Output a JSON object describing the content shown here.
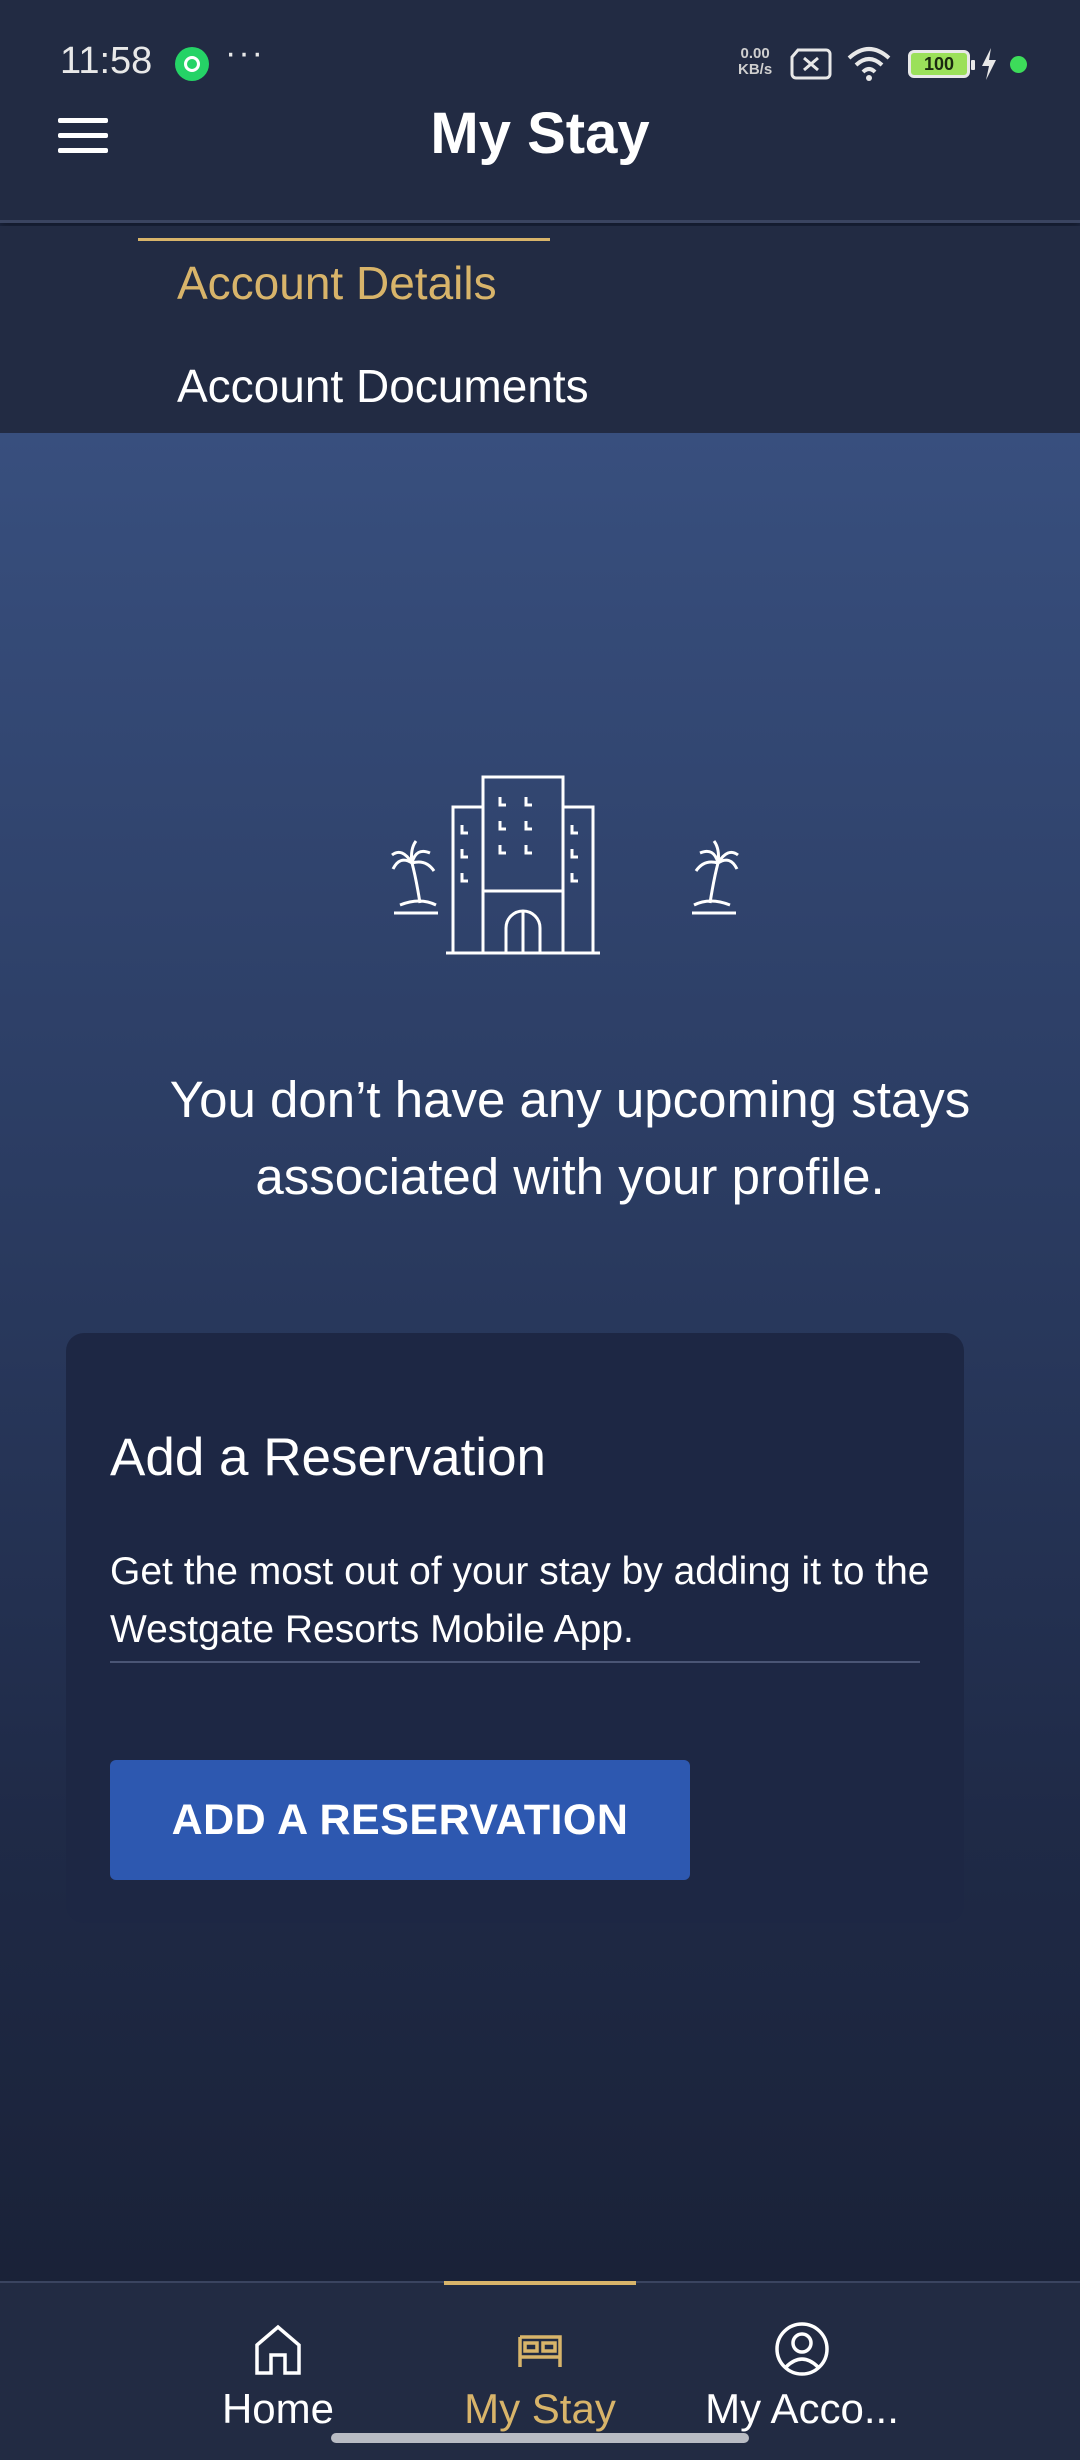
{
  "status_bar": {
    "time": "11:58",
    "more": "···",
    "net_speed_value": "0.00",
    "net_speed_unit": "KB/s",
    "battery": "100"
  },
  "header": {
    "title": "My Stay"
  },
  "subtabs": [
    {
      "label": "Account Details",
      "active": true
    },
    {
      "label": "Account Documents",
      "active": false
    }
  ],
  "empty_state": {
    "message": "You don’t have any upcoming stays associated with your profile."
  },
  "reservation_card": {
    "title": "Add a Reservation",
    "description": "Get the most out of your stay by adding it to the Westgate Resorts Mobile App.",
    "button_label": "ADD A RESERVATION"
  },
  "bottom_nav": {
    "items": [
      {
        "label": "Home",
        "icon": "home-icon",
        "active": false
      },
      {
        "label": "My Stay",
        "icon": "bed-icon",
        "active": true
      },
      {
        "label": "My Acco...",
        "icon": "account-icon",
        "active": false
      }
    ]
  },
  "colors": {
    "accent": "#d8b46a",
    "button": "#2d58b0",
    "header_bg": "#222b43",
    "card_bg": "#1d2744"
  }
}
